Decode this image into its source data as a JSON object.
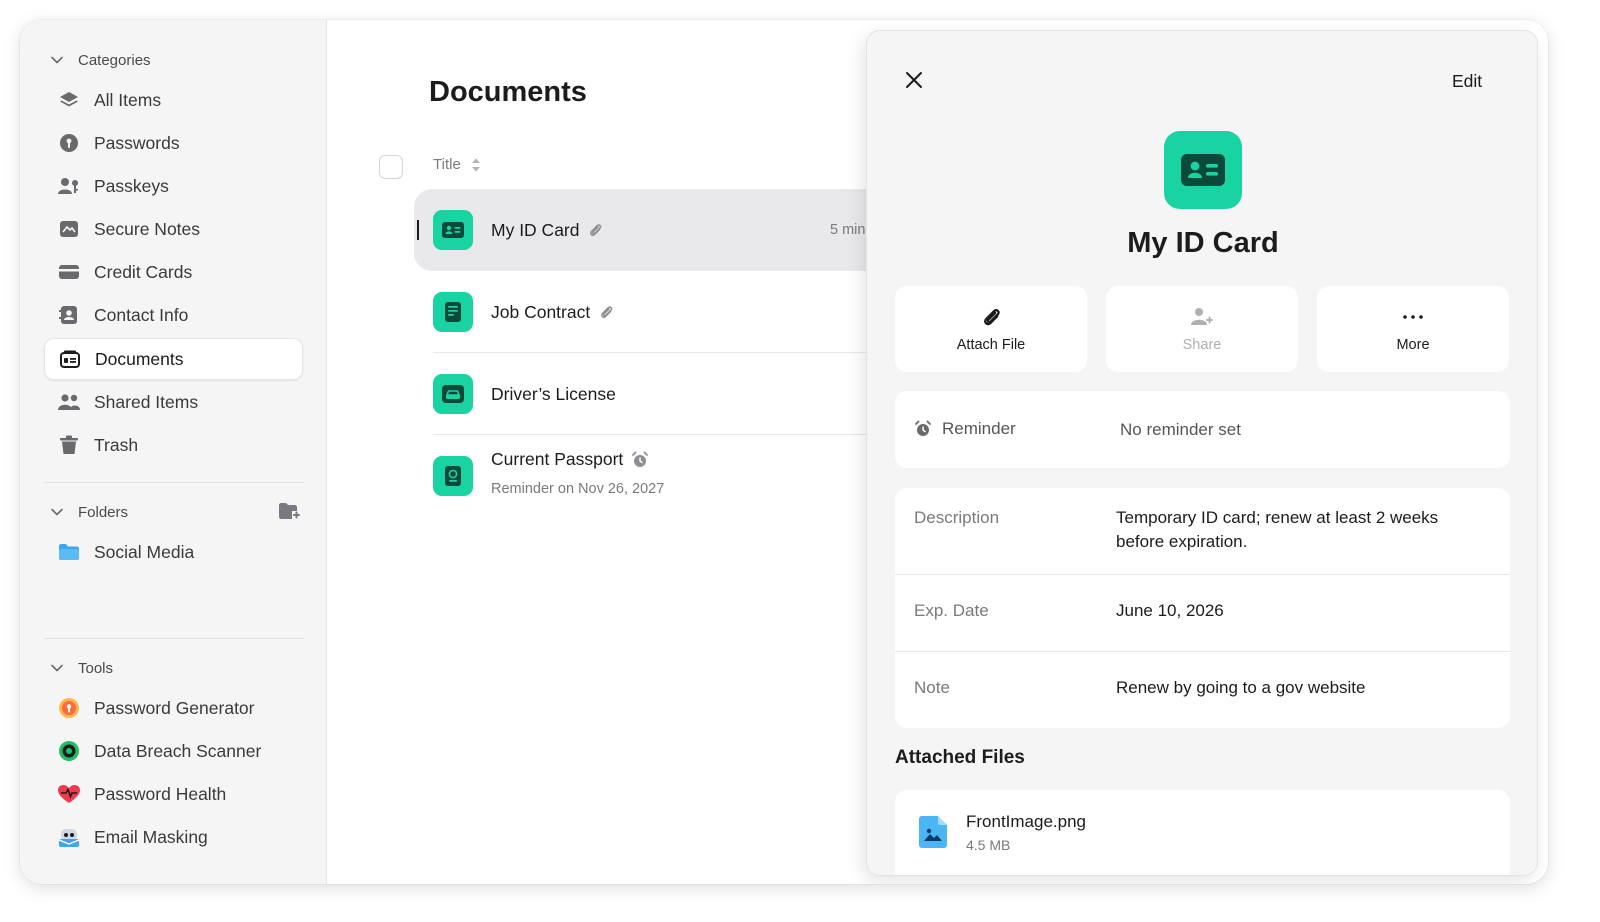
{
  "sidebar": {
    "categories_label": "Categories",
    "categories": [
      {
        "label": "All Items",
        "icon": "layers-icon"
      },
      {
        "label": "Passwords",
        "icon": "key-icon"
      },
      {
        "label": "Passkeys",
        "icon": "passkey-icon"
      },
      {
        "label": "Secure Notes",
        "icon": "note-icon"
      },
      {
        "label": "Credit Cards",
        "icon": "credit-card-icon"
      },
      {
        "label": "Contact Info",
        "icon": "contact-icon"
      },
      {
        "label": "Documents",
        "icon": "document-icon",
        "active": true
      },
      {
        "label": "Shared Items",
        "icon": "people-icon"
      },
      {
        "label": "Trash",
        "icon": "trash-icon"
      }
    ],
    "folders_label": "Folders",
    "folders": [
      {
        "label": "Social Media",
        "icon": "folder-icon"
      }
    ],
    "tools_label": "Tools",
    "tools": [
      {
        "label": "Password Generator",
        "icon": "generator-icon"
      },
      {
        "label": "Data Breach Scanner",
        "icon": "scanner-icon"
      },
      {
        "label": "Password Health",
        "icon": "heart-icon"
      },
      {
        "label": "Email Masking",
        "icon": "mask-icon"
      }
    ]
  },
  "main": {
    "title": "Documents",
    "column_title": "Title",
    "rows": [
      {
        "name": "My ID Card",
        "time": "5 min",
        "attachment": true,
        "selected": true
      },
      {
        "name": "Job Contract",
        "attachment": true
      },
      {
        "name": "Driver’s License"
      },
      {
        "name": "Current Passport",
        "reminder": true,
        "sub": "Reminder on Nov 26, 2027"
      }
    ]
  },
  "detail": {
    "edit_label": "Edit",
    "title": "My ID Card",
    "actions": [
      {
        "label": "Attach File",
        "icon": "paperclip-icon"
      },
      {
        "label": "Share",
        "icon": "share-user-icon",
        "disabled": true
      },
      {
        "label": "More",
        "icon": "more-icon"
      }
    ],
    "reminder_label": "Reminder",
    "reminder_value": "No reminder set",
    "fields": [
      {
        "key": "Description",
        "value": "Temporary ID card; renew at least 2 weeks before expiration."
      },
      {
        "key": "Exp. Date",
        "value": "June 10, 2026"
      },
      {
        "key": "Note",
        "value": "Renew by going to a gov website"
      }
    ],
    "attached_files_label": "Attached Files",
    "files": [
      {
        "name": "FrontImage.png",
        "size": "4.5 MB"
      }
    ]
  },
  "colors": {
    "accent_green": "#19d3a2",
    "icon_dark_green": "#0b4a3a",
    "folder_blue": "#3aa7f0"
  }
}
